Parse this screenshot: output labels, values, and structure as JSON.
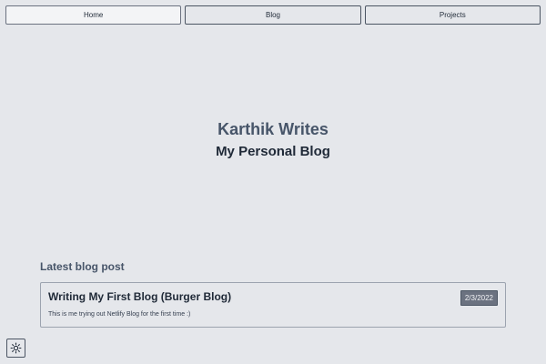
{
  "nav": {
    "tabs": [
      {
        "label": "Home",
        "active": true
      },
      {
        "label": "Blog",
        "active": false
      },
      {
        "label": "Projects",
        "active": false
      }
    ]
  },
  "hero": {
    "title": "Karthik Writes",
    "subtitle": "My Personal Blog"
  },
  "latest": {
    "heading": "Latest blog post",
    "post": {
      "title": "Writing My First Blog (Burger Blog)",
      "date": "2/3/2022",
      "excerpt": "This is me trying out Netlify Blog for the first time :)"
    }
  },
  "theme_toggle": {
    "icon": "sun-icon"
  },
  "colors": {
    "background": "#e5e7eb",
    "accent_title": "#475569",
    "date_badge": "#6b7280"
  }
}
